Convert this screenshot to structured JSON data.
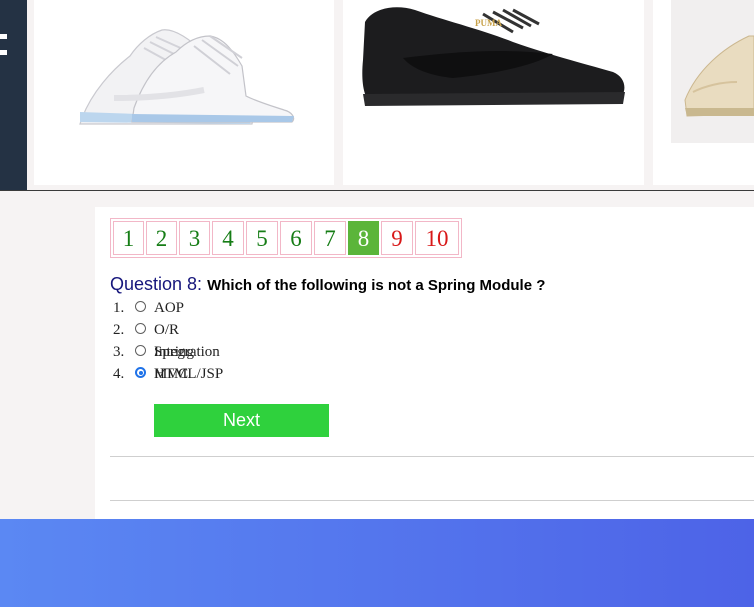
{
  "products": [
    {
      "name": "white-high-top-sneaker"
    },
    {
      "name": "black-suede-sneaker",
      "brand_text": "PUMA"
    },
    {
      "name": "beige-sneaker"
    }
  ],
  "pager": {
    "pages": [
      "1",
      "2",
      "3",
      "4",
      "5",
      "6",
      "7",
      "8",
      "9",
      "10"
    ],
    "current": 8
  },
  "question": {
    "label": "Question 8:",
    "text": "Which of the following is not a Spring Module ?"
  },
  "options": [
    {
      "num": "1.",
      "text": "AOP",
      "selected": false
    },
    {
      "num": "2.",
      "text": "O/R Integration",
      "selected": false
    },
    {
      "num": "3.",
      "text": "Spring MVC",
      "selected": false
    },
    {
      "num": "4.",
      "text": "HTML/JSP",
      "selected": true
    }
  ],
  "next_label": "Next",
  "colors": {
    "visited_page": "#167d16",
    "current_page_bg": "#5bb53a",
    "future_page": "#d81818",
    "next_button": "#2fd13d",
    "footer_start": "#5b88f3",
    "footer_end": "#4d63e7"
  }
}
